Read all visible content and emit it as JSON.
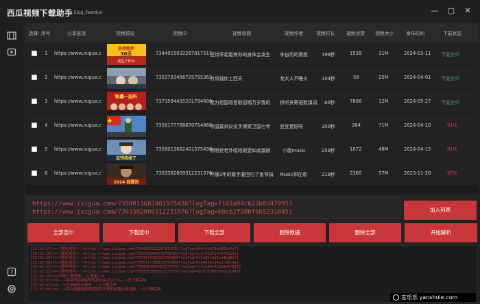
{
  "app": {
    "title": "西瓜视频下载助手",
    "author": "By 52pj_fastdun"
  },
  "window_controls": [
    "—",
    "▢",
    "✕"
  ],
  "nav": {
    "icons": [
      "video-list-icon",
      "play-icon",
      "help-icon",
      "settings-icon"
    ]
  },
  "table": {
    "headers": [
      "选择",
      "序号",
      "分享链接",
      "视频预览",
      "视频ID",
      "视频标题",
      "视频作者",
      "视频时长",
      "视频点赞",
      "视频大小",
      "发布时间",
      "下载状态"
    ],
    "rows": [
      {
        "num": "1",
        "link": "https://www.ixigua.c",
        "id": "7344915032267817511",
        "title": "坚持早起锻炼你的身体会发生",
        "author": "李自尼的猜想",
        "duration": "199秒",
        "likes": "1538",
        "size": "31M",
        "date": "2024-03-11",
        "status": "下载完毕",
        "status_color": "green",
        "thumb_text": "坚持跑步30天你的身体发生了什么"
      },
      {
        "num": "2",
        "link": "https://www.ixigua.c",
        "id": "7352783456725795362",
        "title": "为领袖你上西天",
        "author": "龙大人不睡火",
        "duration": "104秒",
        "likes": "58",
        "size": "25M",
        "date": "2024-04-01",
        "status": "下载完毕",
        "status_color": "green",
        "thumb_text": ""
      },
      {
        "num": "3",
        "link": "https://www.ixigua.c",
        "id": "7373594435201794600",
        "title": "我为祖国唱首歌招唱万岁我的",
        "author": "织听夹寄语数镇词",
        "duration": "60秒",
        "likes": "7806",
        "size": "12M",
        "date": "2024-05-27",
        "status": "下载完毕",
        "status_color": "green",
        "thumb_text": "秋暮一起听"
      },
      {
        "num": "4",
        "link": "https://www.ixigua.c",
        "id": "7356177788870754868",
        "title": "中国最帅仪仗手保家卫国七年",
        "author": "豆豆爱好呀",
        "duration": "350秒",
        "likes": "304",
        "size": "71M",
        "date": "2024-04-10",
        "status": "91%",
        "status_color": "red",
        "thumb_text": ""
      },
      {
        "num": "5",
        "link": "https://www.ixigua.c",
        "id": "7358013682401575436",
        "title": "明明是老外唱戏殿堂如此震撼",
        "author": "小厘music",
        "duration": "259秒",
        "likes": "1672",
        "size": "48M",
        "date": "2024-04-15",
        "status": "81%",
        "status_color": "red",
        "thumb_text": "这钱我掉了"
      },
      {
        "num": "6",
        "link": "https://www.ixigua.c",
        "id": "7303382809312231976",
        "title": "停播3年的歌手要回归了鱼爷捐",
        "author": "Music郑在看",
        "duration": "218秒",
        "likes": "2360",
        "size": "57M",
        "date": "2023-11-20",
        "status": "97%",
        "status_color": "red",
        "thumb_text": "2024 我要回"
      }
    ]
  },
  "url_input": {
    "lines": [
      "https://www.ixigua.com/7358013682401575436?logTag=f141a94c623b8d479953",
      "https://www.ixigua.com/7303382809312231976?logTag=68c62f38bf6b52318451"
    ]
  },
  "buttons": {
    "add": "加入列表",
    "select_all": "全部选中",
    "download_selected": "下载选中",
    "download_all": "下载全部",
    "delete_data": "删除数据",
    "delete_all": "删除全部",
    "start_parse": "开始解析"
  },
  "log": {
    "lines": [
      "[15:16:17]==>[解析成功]-->https://www.ixigua.com/7344915032267817511?logTag=6b4c4a0f8e0803e4e7f",
      "[15:16:18]==>[解析成功]-->https://www.ixigua.com/7352783456725795362?logTag=9c2f81d7a7e5f62a3b1",
      "[15:16:19]==>[解析成功]-->https://www.ixigua.com/7373594435201794600?logTag=0f1a87e4d5ca4bd91f1",
      "[15:16:20]==>[解析成功]-->https://www.ixigua.com/7356177788870754868?logTag=b5a403b1a4e2c9514a9",
      "[15:16:21]==>[解析成功]-->https://www.ixigua.com/7358013682401575436?logTag=f141a94c623b8d479953",
      "[15:16:21]==>[解析成功]-->https://www.ixigua.com/7303382809312231976?logTag=68c62f38bf6b52318451",
      "[15:16:25]==>开始下载任务-->[数量]:6",
      "[15:16:37]==>-->坚持早起锻炼你的身体会发生什么-->已下载完毕",
      "[15:16:37]==>-->为领袖你上西天-->已下载完毕",
      "[15:16:44]==>-->我为祖国唱首歌招唱万岁我的中国心唤雨新-->已下载完毕"
    ]
  },
  "watermark": "言乐乐 yanshule.com"
}
